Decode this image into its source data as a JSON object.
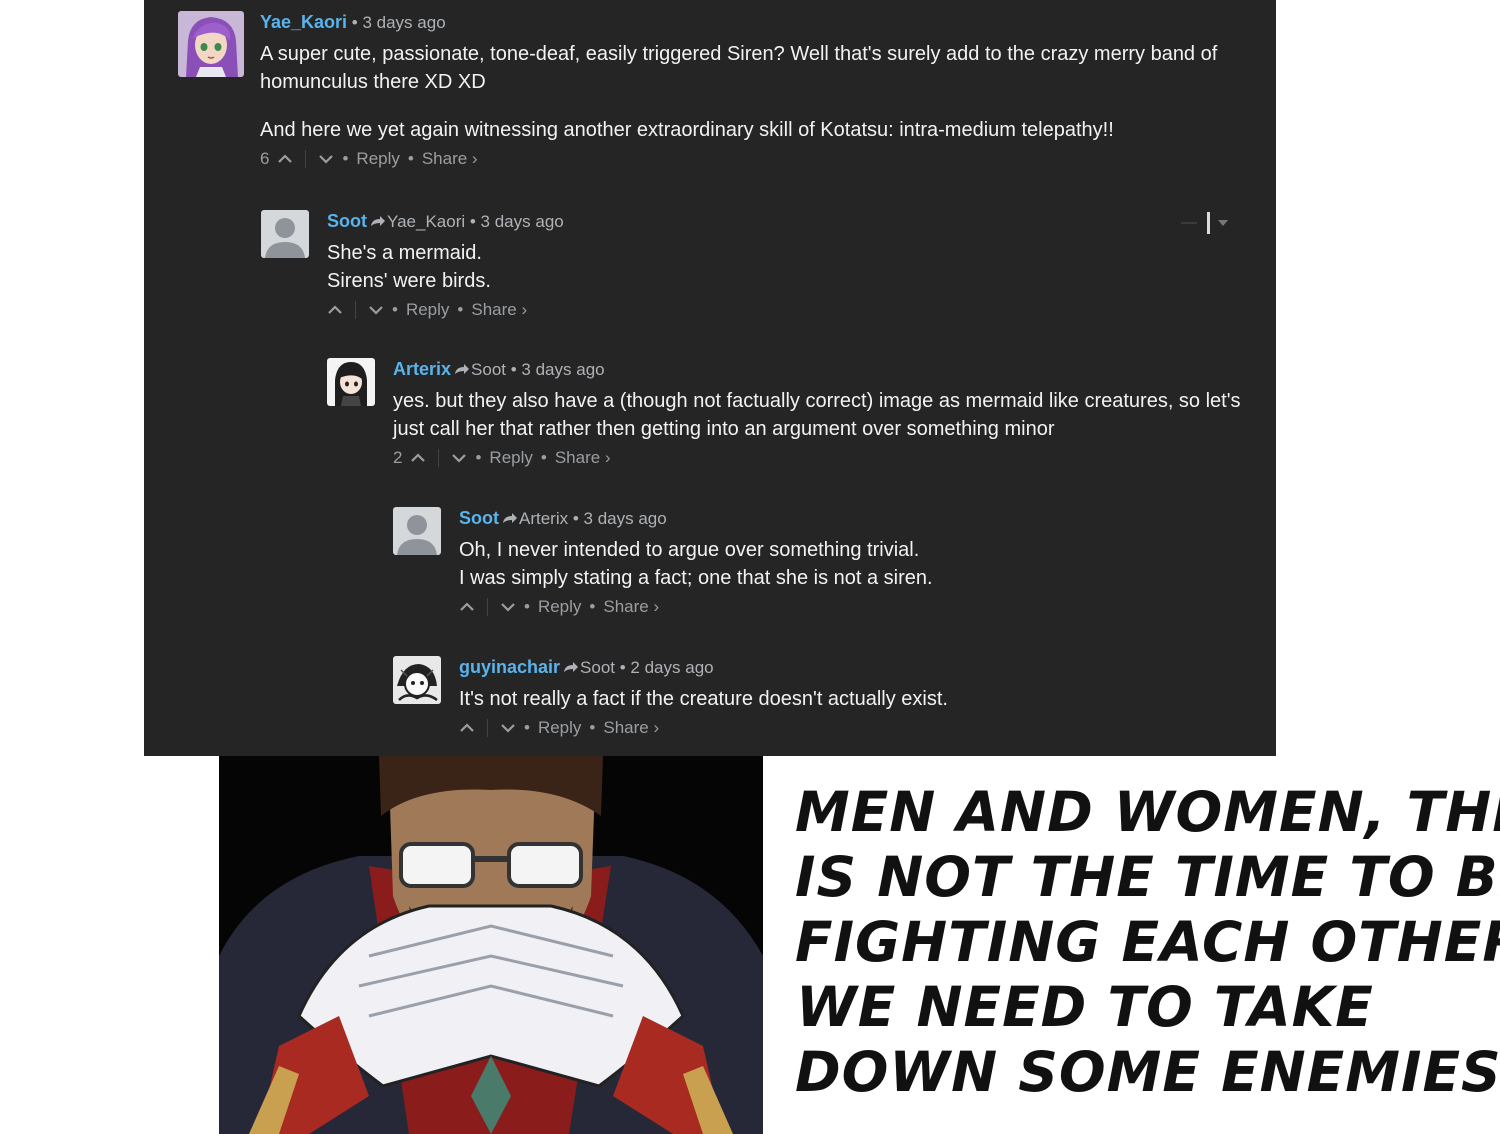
{
  "comments": [
    {
      "author": "Yae_Kaori",
      "reply_to": "",
      "time": "• 3 days ago",
      "lines": [
        "A super cute, passionate, tone-deaf, easily triggered Siren? Well that's surely add to the crazy merry band of homunculus there XD XD"
      ],
      "lines2": [
        "And here we yet again witnessing another extraordinary skill of Kotatsu: intra-medium telepathy!!"
      ],
      "votes": "6",
      "reply_label": "Reply",
      "share_label": "Share ›",
      "avatar": "anime-purple-hair-avatar"
    },
    {
      "author": "Soot",
      "reply_to": "Yae_Kaori",
      "time": "• 3 days ago",
      "lines": [
        "She's a mermaid.",
        "Sirens' were birds."
      ],
      "votes": "",
      "reply_label": "Reply",
      "share_label": "Share ›",
      "avatar": "default-user-avatar"
    },
    {
      "author": "Arterix",
      "reply_to": "Soot",
      "time": "• 3 days ago",
      "lines": [
        "yes. but they also have a (though not factually correct) image as mermaid like creatures, so let's just call her that rather then getting into an argument over something minor"
      ],
      "votes": "2",
      "reply_label": "Reply",
      "share_label": "Share ›",
      "avatar": "anime-dark-hair-avatar"
    },
    {
      "author": "Soot",
      "reply_to": "Arterix",
      "time": "• 3 days ago",
      "lines": [
        "Oh, I never intended to argue over something trivial.",
        "I was simply stating a fact; one that she is not a siren."
      ],
      "votes": "",
      "reply_label": "Reply",
      "share_label": "Share ›",
      "avatar": "default-user-avatar"
    },
    {
      "author": "guyinachair",
      "reply_to": "Soot",
      "time": "• 2 days ago",
      "lines": [
        "It's not really a fact if the creature doesn't actually exist."
      ],
      "votes": "",
      "reply_label": "Reply",
      "share_label": "Share ›",
      "avatar": "manga-sketch-avatar"
    }
  ],
  "meme": {
    "image": "anime-commander-glasses-folded-hands",
    "caption": [
      "MEN AND WOMEN, THIS",
      "IS NOT THE TIME TO BE",
      "FIGHTING EACH OTHER.",
      "WE NEED TO TAKE",
      "DOWN SOME ENEMIES!!"
    ]
  },
  "colors": {
    "background": "#252525",
    "author": "#59b3ec",
    "text": "#f2f2f2",
    "meta": "#aeb2b6"
  }
}
